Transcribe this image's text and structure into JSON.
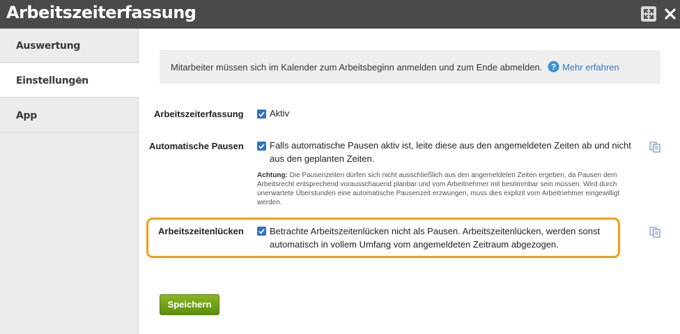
{
  "window": {
    "title": "Arbeitszeiterfassung",
    "buttons": {
      "expand_icon": "expand-icon",
      "close_icon": "close-icon"
    }
  },
  "sidebar": {
    "items": [
      {
        "label": "Auswertung",
        "active": false
      },
      {
        "label": "Einstellungen",
        "active": true,
        "chevron": "chevron-right-icon"
      },
      {
        "label": "App",
        "active": false
      }
    ]
  },
  "info": {
    "text": "Mitarbeiter müssen sich im Kalender zum Arbeitsbeginn anmelden und zum Ende abmelden.",
    "link": "Mehr erfahren"
  },
  "settings": {
    "zeiterfassung": {
      "label": "Arbeitszeiterfassung",
      "checkbox_text": "Aktiv",
      "checked": true
    },
    "pausen": {
      "label": "Automatische Pausen",
      "checked": true,
      "text_line1": "Falls automatische Pausen aktiv ist, leite diese aus den angemeldeten Zeiten ab und nicht",
      "text_line2": "aus den geplanten Zeiten.",
      "warning_title": "Achtung:",
      "warning_line1": "Die Pausenzeiten dürfen sich nicht ausschließlich aus den angemeldeten Zeiten ergeben, da Pausen dem",
      "warning_line2": "Arbeitsrecht entsprechend vorausschauend planbar und vom Arbeitnehmer mit bestimmbar sein müssen. Wird durch",
      "warning_line3": "unerwartete Überstunden eine automatische Pausenzeit erzwungen, muss dies explizit vom Arbeitnehmer eingewilligt",
      "warning_line4": "werden."
    },
    "luecken": {
      "label": "Arbeitszeitenlücken",
      "checked": true,
      "text_line1": "Betrachte Arbeitszeitenlücken nicht als Pausen. Arbeitszeitenlücken, werden sonst",
      "text_line2": "automatisch in vollem Umfang vom angemeldeten Zeitraum abgezogen."
    }
  },
  "actions": {
    "save_label": "Speichern"
  },
  "colors": {
    "titlebar": "#4a4a4a",
    "checkbox": "#2f73c8",
    "link": "#2b7bbf",
    "highlight": "#f39c12",
    "save_button": "#6f9e16"
  }
}
